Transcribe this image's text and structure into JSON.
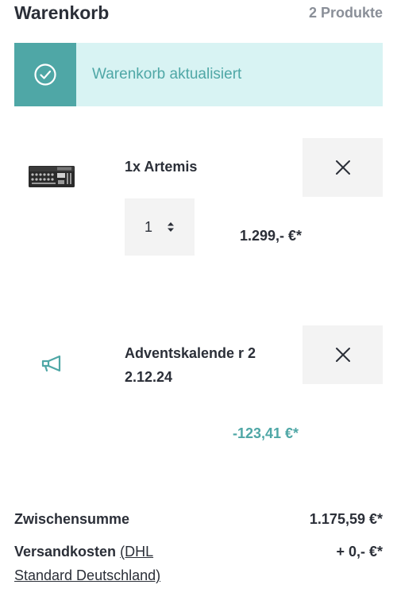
{
  "header": {
    "title": "Warenkorb",
    "product_count": "2 Produkte"
  },
  "banner": {
    "message": "Warenkorb aktualisiert",
    "icon": "check-circle-icon",
    "accent_color": "#4fa7a6",
    "background_color": "#d8f3f3"
  },
  "items": [
    {
      "name": "1x Artemis",
      "thumbnail": "synthesizer-product-image",
      "quantity": "1",
      "price": "1.299,- €*",
      "remove_icon": "close-icon"
    },
    {
      "name": "Adventskalende r 22.12.24",
      "thumbnail": "megaphone-icon",
      "price": "-123,41 €*",
      "remove_icon": "close-icon"
    }
  ],
  "summary": {
    "subtotal_label": "Zwischensumme",
    "subtotal_value": "1.175,59 €*",
    "shipping_label": "Versandkosten",
    "shipping_method": "(DHL Standard Deutschland)",
    "shipping_value": "+ 0,- €*"
  }
}
